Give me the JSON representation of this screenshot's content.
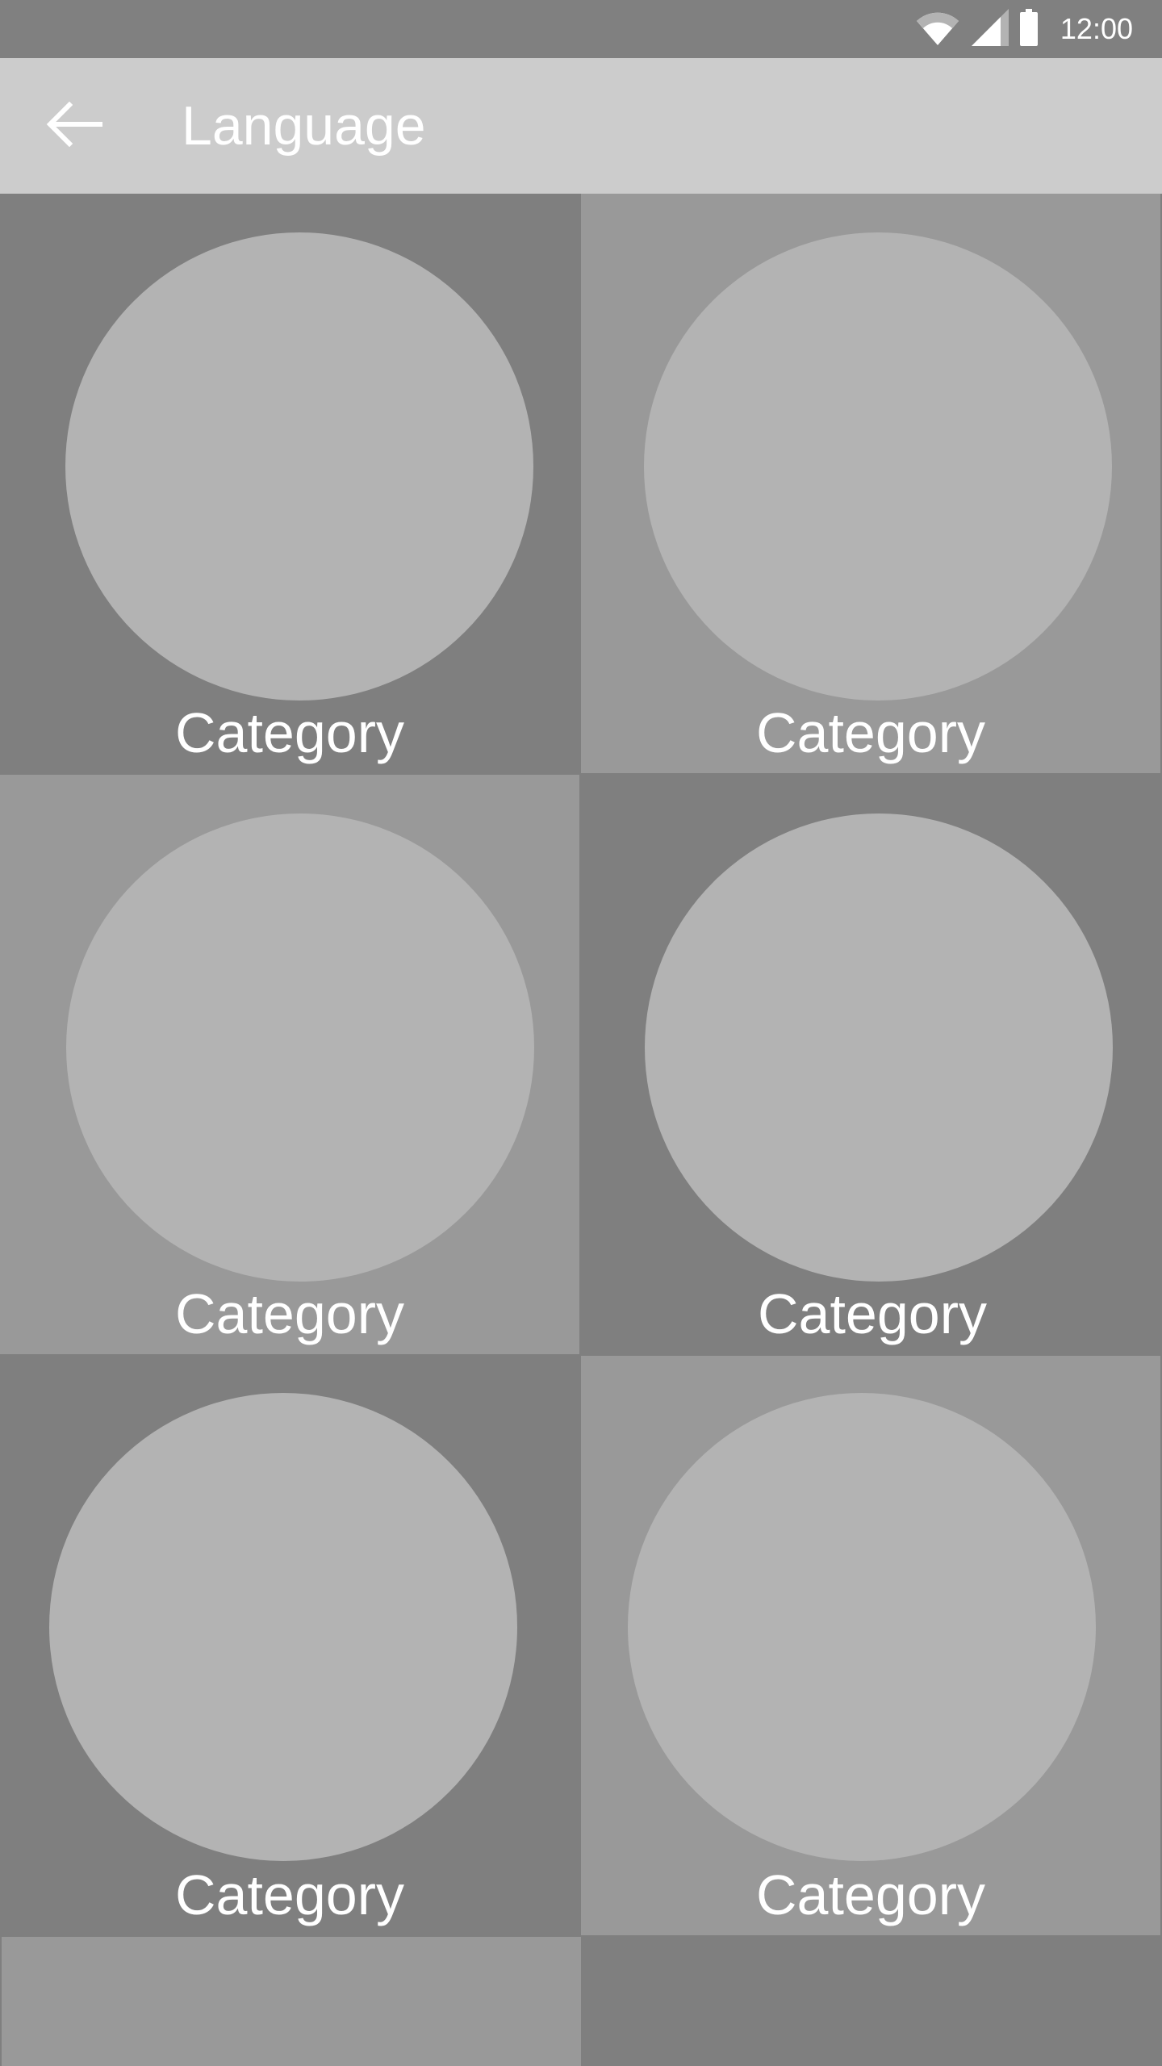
{
  "status_bar": {
    "time": "12:00",
    "icons": [
      "wifi-icon",
      "cell-signal-icon",
      "battery-icon"
    ]
  },
  "app_bar": {
    "title": "Language",
    "back_icon": "arrow-back-icon"
  },
  "grid": {
    "tiles": [
      {
        "label": "Category"
      },
      {
        "label": "Category"
      },
      {
        "label": "Category"
      },
      {
        "label": "Category"
      },
      {
        "label": "Category"
      },
      {
        "label": "Category"
      },
      {
        "label": ""
      },
      {
        "label": ""
      }
    ]
  },
  "colors": {
    "status_bar_bg": "#808080",
    "app_bar_bg": "#cccccc",
    "tile_dark": "#7f7f7f",
    "tile_light": "#999999",
    "circle": "#b3b3b3",
    "text": "#ffffff"
  }
}
